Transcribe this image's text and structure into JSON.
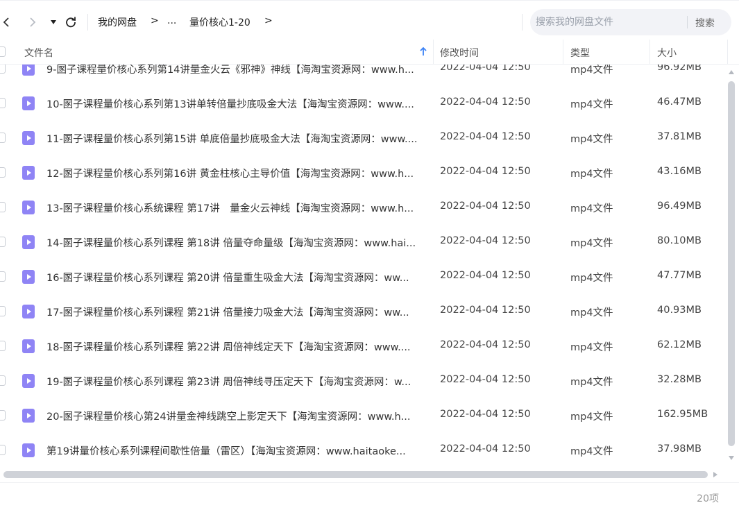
{
  "toolbar": {
    "breadcrumb": {
      "root": "我的网盘",
      "sep1": ">",
      "ellipsis": "...",
      "current": "量价核心1-20",
      "sep2": ">"
    },
    "search": {
      "placeholder": "搜索我的网盘文件",
      "button_label": "搜索"
    }
  },
  "table": {
    "columns": {
      "name": "文件名",
      "modified": "修改时间",
      "type": "类型",
      "size": "大小"
    },
    "rows": [
      {
        "name": "9-圂子课程量价核心系列第14讲量金火云《邪神》神线【海淘宝资源网：www.h...",
        "time": "2022-04-04 12:50",
        "type": "mp4文件",
        "size": "96.92MB"
      },
      {
        "name": "10-圂子课程量价核心系列第13讲单转倍量抄底吸金大法【海淘宝资源网：www....",
        "time": "2022-04-04 12:50",
        "type": "mp4文件",
        "size": "46.47MB"
      },
      {
        "name": "11-圂子课程量价核心系列第15讲 单底倍量抄底吸金大法【海淘宝资源网：www....",
        "time": "2022-04-04 12:50",
        "type": "mp4文件",
        "size": "37.81MB"
      },
      {
        "name": "12-圂子课程量价核心系列第16讲 黄金柱核心主导价值【海淘宝资源网：www.h...",
        "time": "2022-04-04 12:50",
        "type": "mp4文件",
        "size": "43.16MB"
      },
      {
        "name": "13-圂子课程量价核心系统课程 第17讲　量金火云神线【海淘宝资源网：www.h...",
        "time": "2022-04-04 12:50",
        "type": "mp4文件",
        "size": "96.49MB"
      },
      {
        "name": "14-圂子课程量价核心系列课程 第18讲 倍量夺命量级【海淘宝资源网：www.hai...",
        "time": "2022-04-04 12:50",
        "type": "mp4文件",
        "size": "80.10MB"
      },
      {
        "name": "16-圂子课程量价核心系列课程 第20讲 倍量重生吸金大法【海淘宝资源网：ww...",
        "time": "2022-04-04 12:50",
        "type": "mp4文件",
        "size": "47.77MB"
      },
      {
        "name": "17-圂子课程量价核心系列课程 第21讲 倍量接力吸金大法【海淘宝资源网：ww...",
        "time": "2022-04-04 12:50",
        "type": "mp4文件",
        "size": "40.93MB"
      },
      {
        "name": "18-圂子课程量价核心系列课程 第22讲 周倍神线定天下【海淘宝资源网：www....",
        "time": "2022-04-04 12:50",
        "type": "mp4文件",
        "size": "62.12MB"
      },
      {
        "name": "19-圂子课程量价核心系列课程 第23讲 周倍神线寻压定天下【海淘宝资源网：w...",
        "time": "2022-04-04 12:50",
        "type": "mp4文件",
        "size": "32.28MB"
      },
      {
        "name": "20-圂子课程量价核心第24讲量金神线跳空上影定天下【海淘宝资源网：www.h...",
        "time": "2022-04-04 12:50",
        "type": "mp4文件",
        "size": "162.95MB"
      },
      {
        "name": "第19讲量价核心系列课程间歇性倍量（雷区）【海淘宝资源网：www.haitaoke...",
        "time": "2022-04-04 12:50",
        "type": "mp4文件",
        "size": "37.98MB"
      }
    ]
  },
  "footer": {
    "item_count": "20项"
  },
  "colors": {
    "file_icon": "#8f84f5",
    "scrollbar": "#cfd2d8",
    "sort_arrow": "#3b82f6"
  }
}
